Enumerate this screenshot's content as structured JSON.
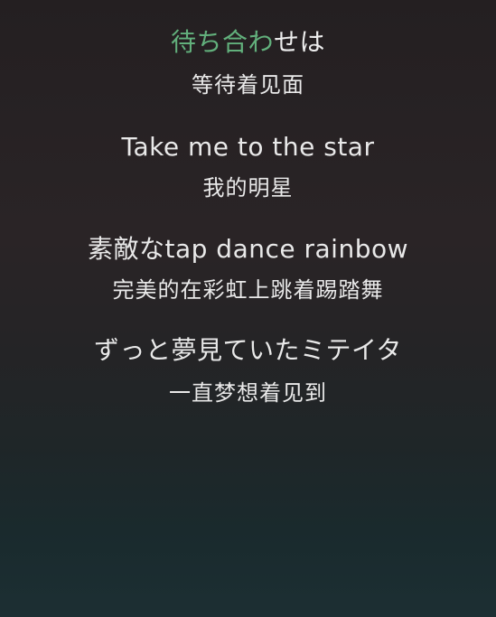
{
  "lyrics": [
    {
      "original_sung": "待ち合わ",
      "original_rest": "せは",
      "translation": "等待着见面"
    },
    {
      "original": "Take me to the star",
      "translation": "我的明星"
    },
    {
      "original": "素敵なtap dance rainbow",
      "translation": "完美的在彩虹上跳着踢踏舞"
    },
    {
      "original": "ずっと夢見ていたミテイタ",
      "translation": "一直梦想着见到"
    }
  ],
  "colors": {
    "active_lyric": "#62b07c",
    "lyric_text": "#ededed"
  }
}
